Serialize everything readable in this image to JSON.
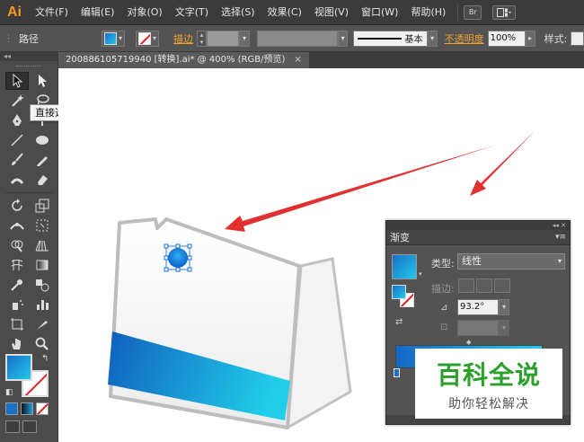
{
  "app": {
    "logo": "Ai"
  },
  "menu": [
    "文件(F)",
    "编辑(E)",
    "对象(O)",
    "文字(T)",
    "选择(S)",
    "效果(C)",
    "视图(V)",
    "窗口(W)",
    "帮助(H)"
  ],
  "menu_buttons": {
    "bridge": "Br",
    "workspace_icon": "workspace-switcher-icon"
  },
  "control_bar": {
    "selection_label": "路径",
    "stroke_link": "描边",
    "stroke_style": "基本",
    "opacity_link": "不透明度",
    "opacity_value": "100%",
    "style_label": "样式:"
  },
  "document_tab": {
    "title": "200886105719940 [转换].ai* @ 400% (RGB/预览)",
    "close": "×"
  },
  "tooltip": "直接选择工具 (A)",
  "tools_icons": [
    "selection-tool-icon",
    "direct-selection-tool-icon",
    "magic-wand-tool-icon",
    "lasso-tool-icon",
    "pen-tool-icon",
    "type-tool-icon",
    "line-segment-tool-icon",
    "ellipse-tool-icon",
    "paintbrush-tool-icon",
    "pencil-tool-icon",
    "blob-brush-tool-icon",
    "eraser-tool-icon",
    "rotate-tool-icon",
    "scale-tool-icon",
    "width-tool-icon",
    "free-transform-tool-icon",
    "shape-builder-tool-icon",
    "perspective-grid-tool-icon",
    "mesh-tool-icon",
    "gradient-tool-icon",
    "eyedropper-tool-icon",
    "blend-tool-icon",
    "symbol-sprayer-tool-icon",
    "column-graph-tool-icon",
    "artboard-tool-icon",
    "slice-tool-icon",
    "hand-tool-icon",
    "zoom-tool-icon"
  ],
  "gradient_panel": {
    "collapse": "◂◂ ✕",
    "title": "渐变",
    "menu_icon": "▾≡",
    "type_label": "类型:",
    "type_value": "线性",
    "stroke_label": "描边:",
    "angle_value": "93.2°",
    "gradient_start": "#1468c4",
    "gradient_end": "#22cdee"
  },
  "colors": {
    "accent_orange": "#f59a23",
    "arrow_red": "#e03030",
    "bag_band_start": "#0f5fbd",
    "bag_band_end": "#21cde9"
  },
  "watermark": {
    "title": "百科全说",
    "subtitle": "助你轻松解决"
  }
}
